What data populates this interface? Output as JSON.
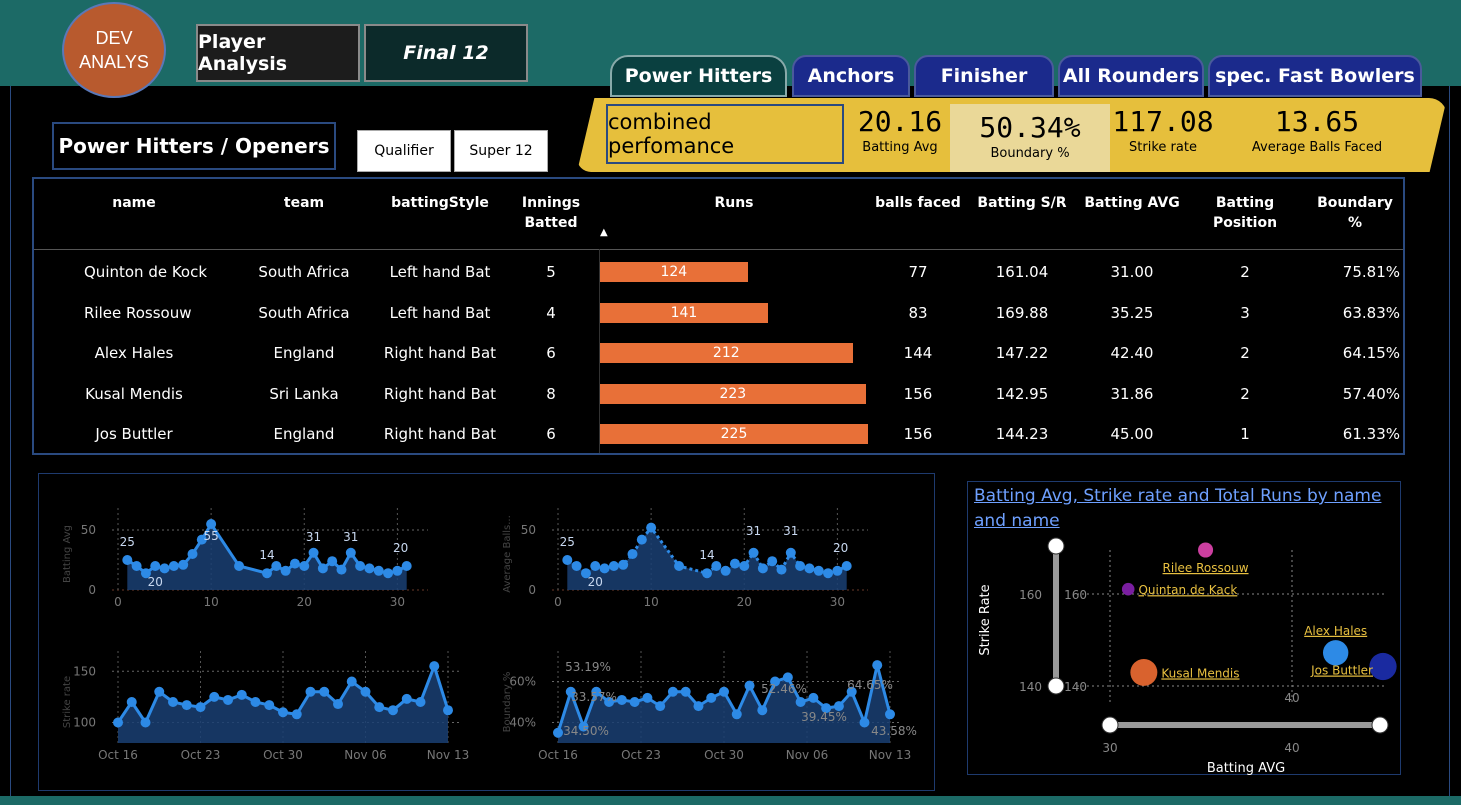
{
  "logo": {
    "line1": "DEV",
    "line2": "ANALYS"
  },
  "header": {
    "player_analysis": "Player Analysis",
    "final12": "Final 12"
  },
  "tabs": [
    {
      "label": "Power Hitters",
      "active": true
    },
    {
      "label": "Anchors"
    },
    {
      "label": "Finisher"
    },
    {
      "label": "All Rounders"
    },
    {
      "label": "spec. Fast Bowlers"
    }
  ],
  "combined": {
    "title": "combined perfomance",
    "kpis": [
      {
        "value": "20.16",
        "label": "Batting Avg"
      },
      {
        "value": "50.34%",
        "label": "Boundary %"
      },
      {
        "value": "117.08",
        "label": "Strike rate"
      },
      {
        "value": "13.65",
        "label": "Average Balls Faced"
      }
    ]
  },
  "section_title": "Power Hitters / Openers",
  "filters": [
    "Qualifier",
    "Super 12"
  ],
  "table": {
    "headers": [
      "name",
      "team",
      "battingStyle",
      "Innings Batted",
      "Runs",
      "balls faced",
      "Batting S/R",
      "Batting AVG",
      "Batting Position",
      "Boundary %"
    ],
    "rows": [
      {
        "name": "Quinton de Kock",
        "team": "South Africa",
        "style": "Left hand Bat",
        "innings": "5",
        "runs": "124",
        "runs_value": 124,
        "balls": "77",
        "sr": "161.04",
        "avg": "31.00",
        "pos": "2",
        "boundary": "75.81%"
      },
      {
        "name": "Rilee Rossouw",
        "team": "South Africa",
        "style": "Left hand Bat",
        "innings": "4",
        "runs": "141",
        "runs_value": 141,
        "balls": "83",
        "sr": "169.88",
        "avg": "35.25",
        "pos": "3",
        "boundary": "63.83%"
      },
      {
        "name": "Alex Hales",
        "team": "England",
        "style": "Right hand Bat",
        "innings": "6",
        "runs": "212",
        "runs_value": 212,
        "balls": "144",
        "sr": "147.22",
        "avg": "42.40",
        "pos": "2",
        "boundary": "64.15%"
      },
      {
        "name": "Kusal Mendis",
        "team": "Sri Lanka",
        "style": "Right hand Bat",
        "innings": "8",
        "runs": "223",
        "runs_value": 223,
        "balls": "156",
        "sr": "142.95",
        "avg": "31.86",
        "pos": "2",
        "boundary": "57.40%"
      },
      {
        "name": "Jos Buttler",
        "team": "England",
        "style": "Right hand Bat",
        "innings": "6",
        "runs": "225",
        "runs_value": 225,
        "balls": "156",
        "sr": "144.23",
        "avg": "45.00",
        "pos": "1",
        "boundary": "61.33%"
      }
    ]
  },
  "chart_data": [
    {
      "type": "area",
      "ylabel": "Batting Avg",
      "ylim": [
        0,
        60
      ],
      "yticks": [
        "0",
        "50"
      ],
      "xticks": [
        "0",
        "10",
        "20",
        "30"
      ],
      "x": [
        1,
        2,
        3,
        4,
        5,
        6,
        7,
        8,
        9,
        10,
        13,
        16,
        17,
        18,
        19,
        20,
        21,
        22,
        23,
        24,
        25,
        26,
        27,
        28,
        29,
        30,
        31
      ],
      "values": [
        25,
        20,
        14,
        20,
        18,
        20,
        21,
        30,
        42,
        55,
        20,
        14,
        20,
        16,
        22,
        20,
        31,
        18,
        24,
        17,
        31,
        20,
        18,
        16,
        14,
        16,
        20
      ],
      "data_labels": [
        "25",
        "20",
        "55",
        "14",
        "31",
        "31",
        "20"
      ]
    },
    {
      "type": "area",
      "ylabel": "Average Balls...",
      "ylim": [
        0,
        60
      ],
      "yticks": [
        "0",
        "50"
      ],
      "xticks": [
        "0",
        "10",
        "20",
        "30"
      ],
      "x": [
        1,
        2,
        3,
        4,
        5,
        6,
        7,
        8,
        9,
        10,
        13,
        16,
        17,
        18,
        19,
        20,
        21,
        22,
        23,
        24,
        25,
        26,
        27,
        28,
        29,
        30,
        31
      ],
      "values": [
        25,
        20,
        14,
        20,
        18,
        20,
        21,
        30,
        42,
        52,
        20,
        14,
        20,
        16,
        22,
        20,
        31,
        18,
        24,
        17,
        31,
        20,
        18,
        16,
        14,
        16,
        20
      ],
      "data_labels": [
        "25",
        "20",
        "14",
        "31",
        "31",
        "20"
      ]
    },
    {
      "type": "area",
      "ylabel": "Strike rate",
      "ylim": [
        80,
        160
      ],
      "yticks": [
        "100",
        "150"
      ],
      "xticks": [
        "Oct 16",
        "Oct 23",
        "Oct 30",
        "Nov 06",
        "Nov 13"
      ],
      "values": [
        100,
        120,
        100,
        130,
        120,
        117,
        115,
        125,
        122,
        127,
        120,
        117,
        110,
        108,
        130,
        130,
        118,
        140,
        130,
        115,
        112,
        123,
        120,
        155,
        112
      ]
    },
    {
      "type": "area",
      "ylabel": "Boundary %",
      "ylim": [
        30,
        70
      ],
      "yticks": [
        "40%",
        "60%"
      ],
      "xticks": [
        "Oct 16",
        "Oct 23",
        "Oct 30",
        "Nov 06",
        "Nov 13"
      ],
      "values": [
        35,
        55,
        38,
        55,
        50,
        51,
        50,
        52,
        48,
        55,
        55,
        48,
        52,
        55,
        44,
        58,
        46,
        60,
        62,
        50,
        52,
        47,
        48,
        55,
        40,
        68,
        44
      ],
      "data_labels": [
        "53.19%",
        "33.57%",
        "34.50%",
        "52.46%",
        "39.45%",
        "64.65%",
        "43.58%"
      ]
    },
    {
      "type": "scatter",
      "title": "Batting Avg, Strike rate and Total Runs by name and name",
      "xlabel": "Batting AVG",
      "ylabel": "Strike Rate",
      "xticks": [
        "30",
        "40"
      ],
      "yticks": [
        "140",
        "160"
      ],
      "points": [
        {
          "name": "Rilee Rossouw",
          "x": 35.25,
          "y": 169.88,
          "runs": 141,
          "color": "#cc3fa0"
        },
        {
          "name": "Quintan de Kack",
          "x": 31.0,
          "y": 161.04,
          "runs": 124,
          "color": "#7a1ea0"
        },
        {
          "name": "Alex Hales",
          "x": 42.4,
          "y": 147.22,
          "runs": 212,
          "color": "#2d8ae6"
        },
        {
          "name": "Jos Buttler",
          "x": 45.0,
          "y": 144.23,
          "runs": 225,
          "color": "#1a2aa0"
        },
        {
          "name": "Kusal Mendis",
          "x": 31.86,
          "y": 142.95,
          "runs": 223,
          "color": "#d9622e"
        }
      ]
    }
  ],
  "colors": {
    "bar": "#e87038",
    "line": "#2d8ae6",
    "area": "#1a3f73",
    "kpi_bg": "#e6bf3c",
    "teal": "#1c6a66"
  }
}
